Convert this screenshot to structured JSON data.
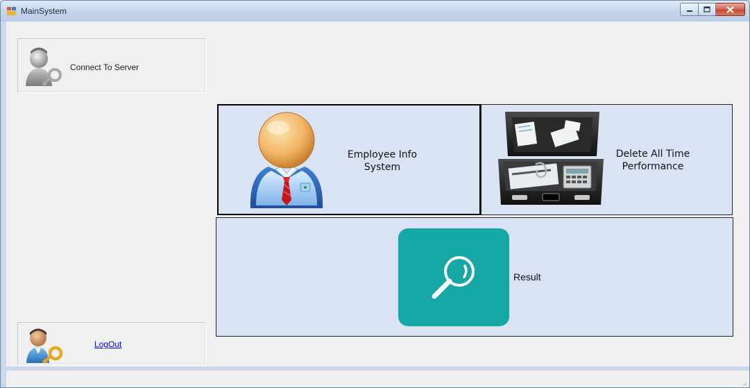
{
  "window": {
    "title": "MainSystem",
    "controls": {
      "minimize": "minimize",
      "maximize": "maximize",
      "close": "close"
    }
  },
  "sidebar": {
    "connect_label": "Connect To Server",
    "logout_label": "LogOut"
  },
  "tiles": {
    "employee": {
      "line1": "Employee Info",
      "line2": "System"
    },
    "delete": {
      "line1": "Delete All Time",
      "line2": "Performance"
    },
    "result": {
      "label": "Result"
    }
  },
  "icons": {
    "app": "app-window-icon",
    "connect": "user-key-icon",
    "logout": "user-key-icon",
    "employee": "employee-avatar-icon",
    "delete": "briefcase-icon",
    "result": "magnifier-icon"
  },
  "colors": {
    "tile_background": "#dae3f3",
    "result_accent": "#15a7a5",
    "link": "#0000ee"
  }
}
